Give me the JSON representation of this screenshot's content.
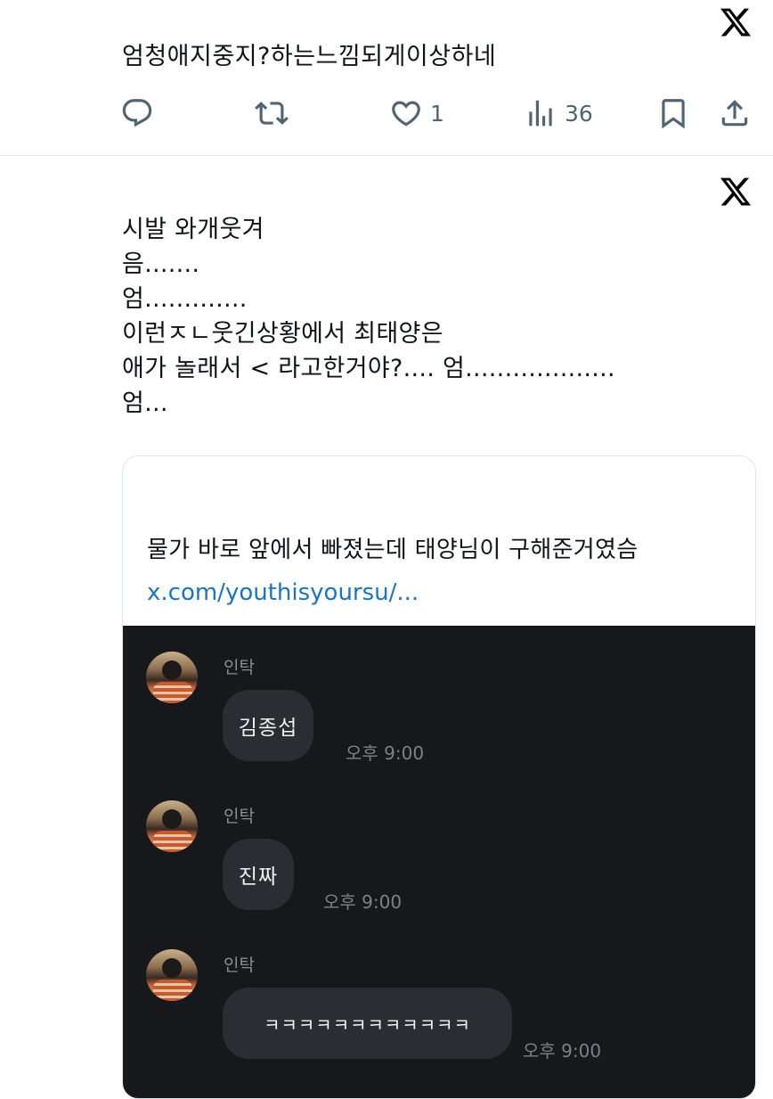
{
  "tweet1": {
    "text": "엄청애지중지?하는느낌되게이상하네",
    "actions": {
      "reply_count": "",
      "retweet_count": "",
      "like_count": "1",
      "views_count": "36"
    }
  },
  "tweet2": {
    "lines": [
      "시발 와개웃겨",
      "음.......",
      "엄.............",
      "이런ㅈㄴ웃긴상황에서 최태양은",
      "애가 놀래서 < 라고한거야?.... 엄...................",
      "엄..."
    ],
    "quote": {
      "text": "물가 바로 앞에서 빠졌는데 태양님이 구해준거였슴",
      "link": "x.com/youthisyoursu/...",
      "chat": [
        {
          "sender": "인탁",
          "message": "김종섭",
          "time": "오후 9:00"
        },
        {
          "sender": "인탁",
          "message": "진짜",
          "time": "오후 9:00"
        },
        {
          "sender": "인탁",
          "message": "ㅋㅋㅋㅋㅋㅋㅋㅋㅋㅋㅋㅋ",
          "time": "오후 9:00"
        }
      ]
    }
  },
  "icons": {
    "brand": "x-logo-icon",
    "reply": "comment-icon",
    "retweet": "retweet-icon",
    "like": "heart-icon",
    "views": "bar-chart-icon",
    "bookmark": "bookmark-icon",
    "share": "share-icon"
  },
  "colors": {
    "text": "#0f1419",
    "muted": "#536471",
    "link": "#1d74bd",
    "chat_background": "#17181c",
    "bubble": "#2c2d33"
  }
}
